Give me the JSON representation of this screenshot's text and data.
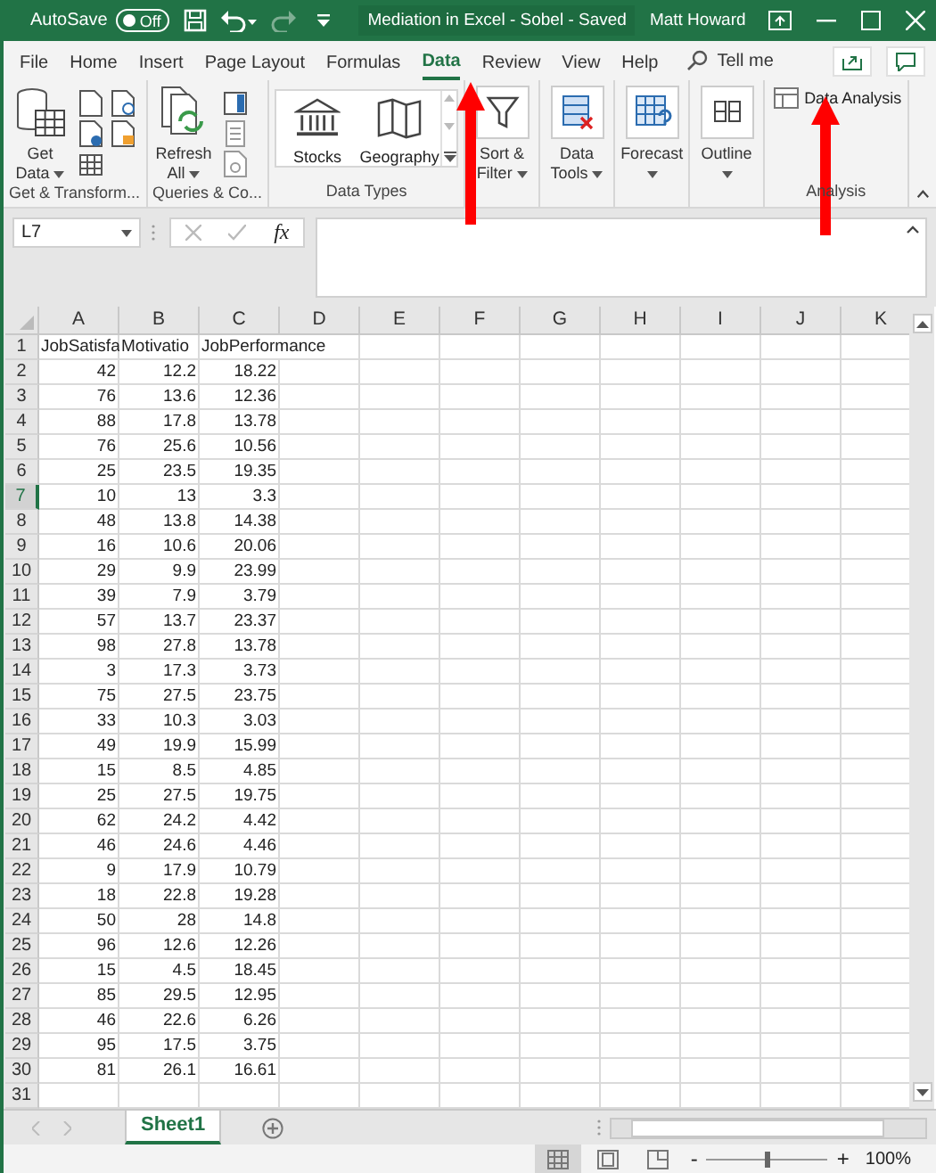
{
  "title_bar": {
    "autosave_label": "AutoSave",
    "autosave": {
      "label": "Off",
      "on": false
    },
    "document_title": "Mediation in Excel - Sobel  -  Saved",
    "user": "Matt Howard"
  },
  "ribbon_tabs": [
    {
      "label": "File",
      "selected": false
    },
    {
      "label": "Home",
      "selected": false
    },
    {
      "label": "Insert",
      "selected": false
    },
    {
      "label": "Page Layout",
      "selected": false
    },
    {
      "label": "Formulas",
      "selected": false
    },
    {
      "label": "Data",
      "selected": true
    },
    {
      "label": "Review",
      "selected": false
    },
    {
      "label": "View",
      "selected": false
    },
    {
      "label": "Help",
      "selected": false
    }
  ],
  "tell_me": "Tell me",
  "ribbon_groups": [
    {
      "name": "Get & Transform...",
      "items": [
        {
          "kind": "large",
          "label": "Get Data",
          "menu": true
        },
        {
          "kind": "icon"
        },
        {
          "kind": "icon"
        },
        {
          "kind": "icon"
        },
        {
          "kind": "icon"
        },
        {
          "kind": "icon"
        }
      ]
    },
    {
      "name": "Queries & Co...",
      "items": [
        {
          "kind": "large",
          "label": "Refresh All",
          "menu": true
        },
        {
          "kind": "icon"
        },
        {
          "kind": "icon"
        },
        {
          "kind": "icon"
        }
      ]
    },
    {
      "name": "Data Types",
      "items": [
        {
          "kind": "gallery",
          "items": [
            {
              "label": "Stocks"
            },
            {
              "label": "Geography"
            }
          ]
        }
      ]
    },
    {
      "items": [
        {
          "kind": "large",
          "label": "Sort & Filter",
          "menu": true
        }
      ]
    },
    {
      "items": [
        {
          "kind": "large",
          "label": "Data Tools",
          "menu": true
        }
      ]
    },
    {
      "items": [
        {
          "kind": "large",
          "label": "Forecast",
          "menu": true
        }
      ]
    },
    {
      "items": [
        {
          "kind": "large",
          "label": "Outline",
          "menu": true
        }
      ]
    },
    {
      "name": "Analysis",
      "items": [
        {
          "kind": "small",
          "label": "Data Analysis"
        }
      ]
    }
  ],
  "formula_bar": {
    "name_box": "L7",
    "function_label": "fx"
  },
  "sheet": {
    "columns": [
      "A",
      "B",
      "C",
      "D",
      "E",
      "F",
      "G",
      "H",
      "I",
      "J",
      "K"
    ],
    "rows": [
      {
        "number": "1",
        "kind": "header",
        "selected": false,
        "cells": [
          "JobSatisfa",
          "Motivatio",
          "JobPerformance"
        ]
      },
      {
        "number": "2",
        "kind": "data",
        "selected": false,
        "cells": [
          "42",
          "12.2",
          "18.22"
        ]
      },
      {
        "number": "3",
        "kind": "data",
        "selected": false,
        "cells": [
          "76",
          "13.6",
          "12.36"
        ]
      },
      {
        "number": "4",
        "kind": "data",
        "selected": false,
        "cells": [
          "88",
          "17.8",
          "13.78"
        ]
      },
      {
        "number": "5",
        "kind": "data",
        "selected": false,
        "cells": [
          "76",
          "25.6",
          "10.56"
        ]
      },
      {
        "number": "6",
        "kind": "data",
        "selected": false,
        "cells": [
          "25",
          "23.5",
          "19.35"
        ]
      },
      {
        "number": "7",
        "kind": "data",
        "selected": true,
        "cells": [
          "10",
          "13",
          "3.3"
        ]
      },
      {
        "number": "8",
        "kind": "data",
        "selected": false,
        "cells": [
          "48",
          "13.8",
          "14.38"
        ]
      },
      {
        "number": "9",
        "kind": "data",
        "selected": false,
        "cells": [
          "16",
          "10.6",
          "20.06"
        ]
      },
      {
        "number": "10",
        "kind": "data",
        "selected": false,
        "cells": [
          "29",
          "9.9",
          "23.99"
        ]
      },
      {
        "number": "11",
        "kind": "data",
        "selected": false,
        "cells": [
          "39",
          "7.9",
          "3.79"
        ]
      },
      {
        "number": "12",
        "kind": "data",
        "selected": false,
        "cells": [
          "57",
          "13.7",
          "23.37"
        ]
      },
      {
        "number": "13",
        "kind": "data",
        "selected": false,
        "cells": [
          "98",
          "27.8",
          "13.78"
        ]
      },
      {
        "number": "14",
        "kind": "data",
        "selected": false,
        "cells": [
          "3",
          "17.3",
          "3.73"
        ]
      },
      {
        "number": "15",
        "kind": "data",
        "selected": false,
        "cells": [
          "75",
          "27.5",
          "23.75"
        ]
      },
      {
        "number": "16",
        "kind": "data",
        "selected": false,
        "cells": [
          "33",
          "10.3",
          "3.03"
        ]
      },
      {
        "number": "17",
        "kind": "data",
        "selected": false,
        "cells": [
          "49",
          "19.9",
          "15.99"
        ]
      },
      {
        "number": "18",
        "kind": "data",
        "selected": false,
        "cells": [
          "15",
          "8.5",
          "4.85"
        ]
      },
      {
        "number": "19",
        "kind": "data",
        "selected": false,
        "cells": [
          "25",
          "27.5",
          "19.75"
        ]
      },
      {
        "number": "20",
        "kind": "data",
        "selected": false,
        "cells": [
          "62",
          "24.2",
          "4.42"
        ]
      },
      {
        "number": "21",
        "kind": "data",
        "selected": false,
        "cells": [
          "46",
          "24.6",
          "4.46"
        ]
      },
      {
        "number": "22",
        "kind": "data",
        "selected": false,
        "cells": [
          "9",
          "17.9",
          "10.79"
        ]
      },
      {
        "number": "23",
        "kind": "data",
        "selected": false,
        "cells": [
          "18",
          "22.8",
          "19.28"
        ]
      },
      {
        "number": "24",
        "kind": "data",
        "selected": false,
        "cells": [
          "50",
          "28",
          "14.8"
        ]
      },
      {
        "number": "25",
        "kind": "data",
        "selected": false,
        "cells": [
          "96",
          "12.6",
          "12.26"
        ]
      },
      {
        "number": "26",
        "kind": "data",
        "selected": false,
        "cells": [
          "15",
          "4.5",
          "18.45"
        ]
      },
      {
        "number": "27",
        "kind": "data",
        "selected": false,
        "cells": [
          "85",
          "29.5",
          "12.95"
        ]
      },
      {
        "number": "28",
        "kind": "data",
        "selected": false,
        "cells": [
          "46",
          "22.6",
          "6.26"
        ]
      },
      {
        "number": "29",
        "kind": "data",
        "selected": false,
        "cells": [
          "95",
          "17.5",
          "3.75"
        ]
      },
      {
        "number": "30",
        "kind": "data",
        "selected": false,
        "cells": [
          "81",
          "26.1",
          "16.61"
        ]
      },
      {
        "number": "31",
        "kind": "data",
        "selected": false,
        "cells": []
      }
    ]
  },
  "sheet_tabs": [
    {
      "label": "Sheet1",
      "selected": true
    }
  ],
  "status_bar": {
    "views": [
      {
        "selected": true
      },
      {
        "selected": false
      },
      {
        "selected": false
      }
    ],
    "zoom_out": "-",
    "zoom_in": "+",
    "zoom": {
      "level": 0.5
    },
    "zoom_label": "100%"
  }
}
